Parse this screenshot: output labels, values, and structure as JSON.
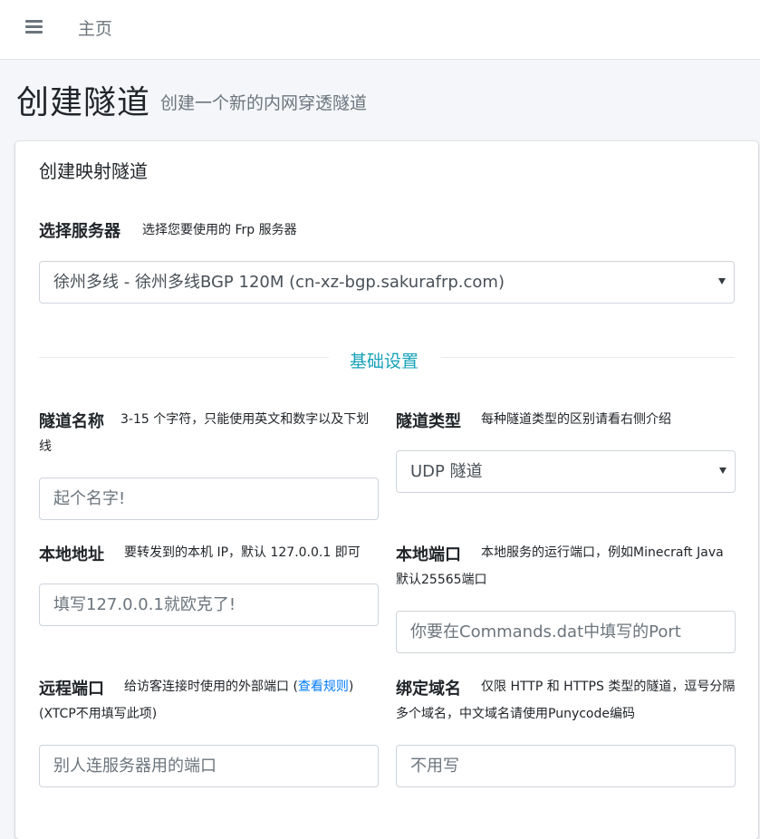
{
  "topbar": {
    "menu_icon": "hamburger-menu-icon",
    "home_label": "主页"
  },
  "header": {
    "title": "创建隧道",
    "subtitle": "创建一个新的内网穿透隧道"
  },
  "card": {
    "title": "创建映射隧道",
    "server": {
      "label": "选择服务器",
      "hint": "选择您要使用的 Frp 服务器",
      "selected": "徐州多线 - 徐州多线BGP 120M (cn-xz-bgp.sakurafrp.com)"
    },
    "section_basic": "基础设置",
    "tunnel_name": {
      "label": "隧道名称",
      "hint": "3-15 个字符，只能使用英文和数字以及下划线",
      "placeholder": "起个名字!"
    },
    "tunnel_type": {
      "label": "隧道类型",
      "hint": "每种隧道类型的区别请看右侧介绍",
      "selected": "UDP 隧道"
    },
    "local_addr": {
      "label": "本地地址",
      "hint": "要转发到的本机 IP，默认 127.0.0.1 即可",
      "placeholder": "填写127.0.0.1就欧克了!"
    },
    "local_port": {
      "label": "本地端口",
      "hint": "本地服务的运行端口，例如Minecraft Java默认25565端口",
      "placeholder": "你要在Commands.dat中填写的Port"
    },
    "remote_port": {
      "label": "远程端口",
      "hint_before": "给访客连接时使用的外部端口 (",
      "hint_link": "查看规则",
      "hint_after": ")(XTCP不用填写此项)",
      "placeholder": "别人连服务器用的端口"
    },
    "bind_domain": {
      "label": "绑定域名",
      "hint": "仅限 HTTP 和 HTTPS 类型的隧道，逗号分隔多个域名，中文域名请使用Punycode编码",
      "placeholder": "不用写"
    }
  },
  "colors": {
    "accent_teal": "#17a2b8",
    "link_blue": "#007bff",
    "background": "#f4f6f9"
  }
}
